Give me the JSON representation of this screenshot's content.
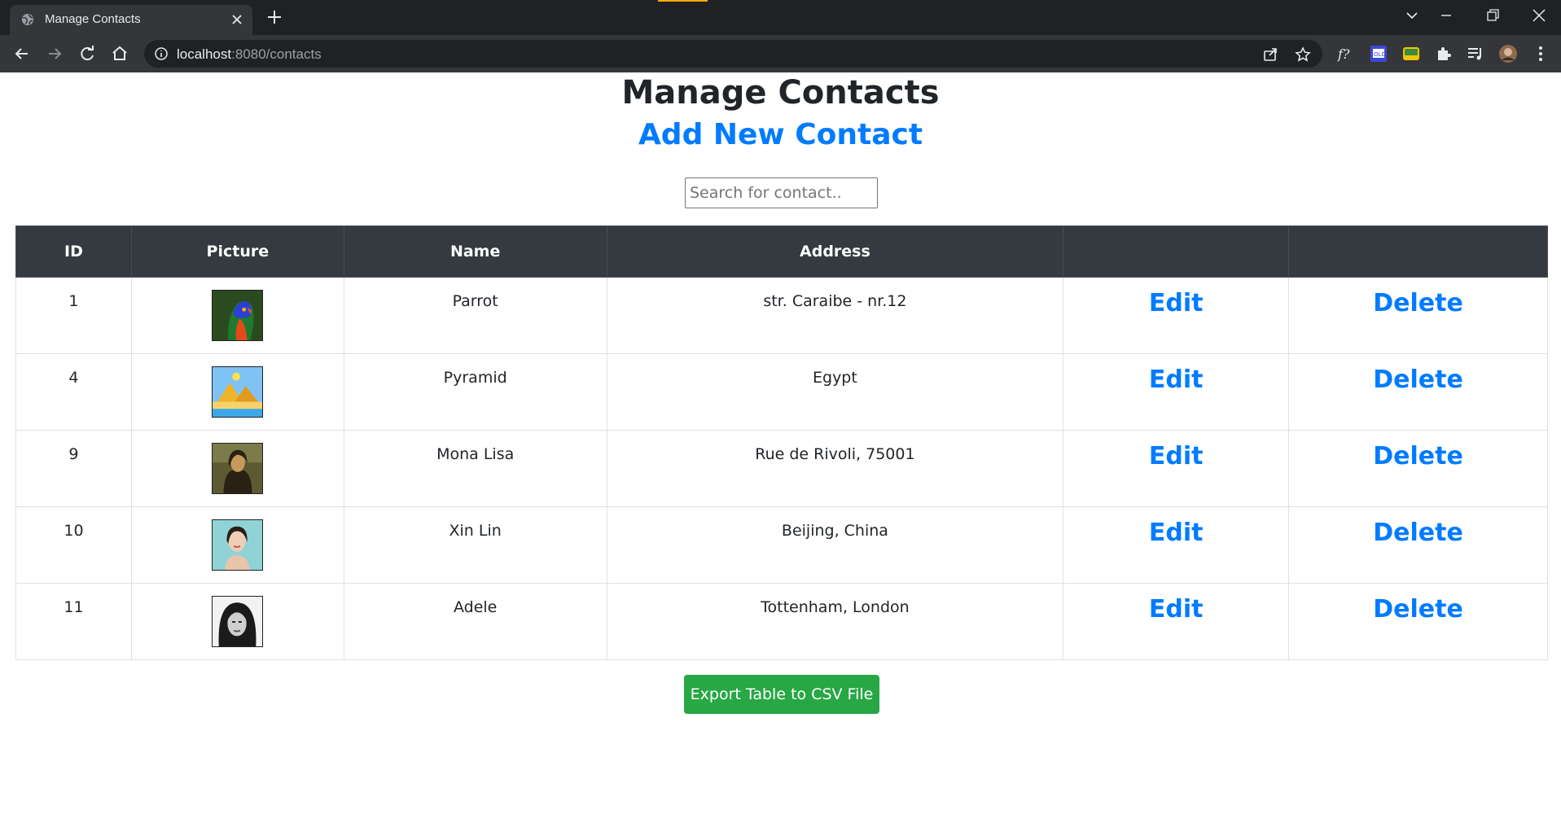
{
  "browser": {
    "tab_title": "Manage Contacts",
    "url_host": "localhost",
    "url_rest": ":8080/contacts"
  },
  "page": {
    "title": "Manage Contacts",
    "add_link": "Add New Contact",
    "search_placeholder": "Search for contact..",
    "export_button": "Export Table to CSV File"
  },
  "table": {
    "headers": [
      "ID",
      "Picture",
      "Name",
      "Address",
      "",
      ""
    ],
    "rows": [
      {
        "id": "1",
        "picture": "parrot-image",
        "name": "Parrot",
        "address": "str. Caraibe - nr.12",
        "edit": "Edit",
        "delete": "Delete"
      },
      {
        "id": "4",
        "picture": "pyramid-image",
        "name": "Pyramid",
        "address": "Egypt",
        "edit": "Edit",
        "delete": "Delete"
      },
      {
        "id": "9",
        "picture": "mona-lisa-image",
        "name": "Mona Lisa",
        "address": "Rue de Rivoli, 75001",
        "edit": "Edit",
        "delete": "Delete"
      },
      {
        "id": "10",
        "picture": "portrait-image",
        "name": "Xin Lin",
        "address": "Beijing, China",
        "edit": "Edit",
        "delete": "Delete"
      },
      {
        "id": "11",
        "picture": "bw-portrait-image",
        "name": "Adele",
        "address": "Tottenham, London",
        "edit": "Edit",
        "delete": "Delete"
      }
    ]
  },
  "colors": {
    "link": "#007bff",
    "table_header_bg": "#343a40",
    "export_button_bg": "#28a745",
    "chrome_dark": "#202124",
    "chrome_toolbar": "#35363a"
  }
}
